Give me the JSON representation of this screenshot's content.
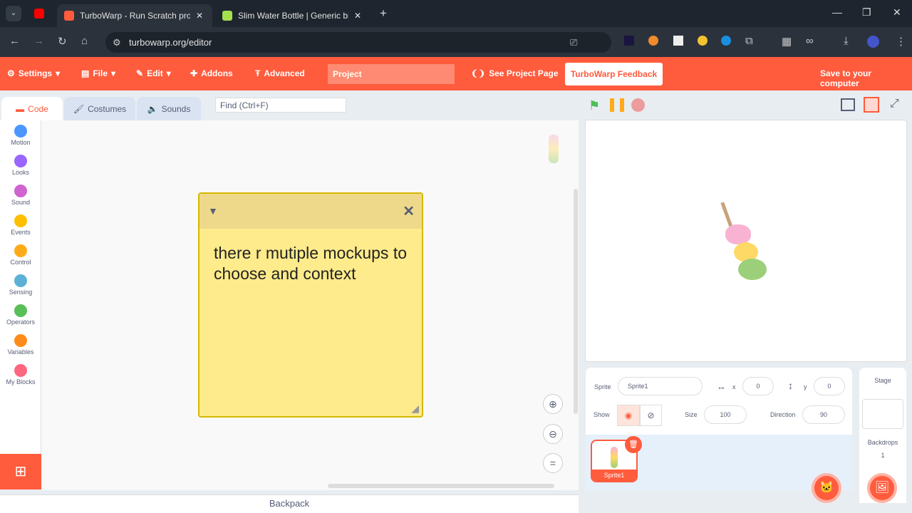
{
  "browser": {
    "tabs": [
      {
        "label": "TurboWarp - Run Scratch proje",
        "active": true
      },
      {
        "label": "Slim Water Bottle | Generic bra",
        "active": false
      }
    ],
    "url": "turbowarp.org/editor"
  },
  "menu": {
    "settings": "Settings",
    "file": "File",
    "edit": "Edit",
    "addons": "Addons",
    "advanced": "Advanced",
    "project_title": "Project",
    "see_project_page": "See Project Page",
    "feedback": "TurboWarp Feedback",
    "save": "Save to your computer"
  },
  "editor_tabs": {
    "code": "Code",
    "costumes": "Costumes",
    "sounds": "Sounds"
  },
  "find_placeholder": "Find (Ctrl+F)",
  "categories": [
    {
      "label": "Motion",
      "color": "#4c97ff"
    },
    {
      "label": "Looks",
      "color": "#9966ff"
    },
    {
      "label": "Sound",
      "color": "#cf63cf"
    },
    {
      "label": "Events",
      "color": "#ffbf00"
    },
    {
      "label": "Control",
      "color": "#ffab19"
    },
    {
      "label": "Sensing",
      "color": "#5cb1d6"
    },
    {
      "label": "Operators",
      "color": "#59c059"
    },
    {
      "label": "Variables",
      "color": "#ff8c1a"
    },
    {
      "label": "My Blocks",
      "color": "#ff6680"
    }
  ],
  "note": {
    "text": "there r mutiple mockups to choose and context"
  },
  "backpack": "Backpack",
  "sprite_info": {
    "sprite_label": "Sprite",
    "sprite_name": "Sprite1",
    "x_label": "x",
    "x": "0",
    "y_label": "y",
    "y": "0",
    "show_label": "Show",
    "size_label": "Size",
    "size": "100",
    "direction_label": "Direction",
    "direction": "90"
  },
  "sprites": [
    {
      "name": "Sprite1"
    }
  ],
  "stage_pane": {
    "title": "Stage",
    "backdrops_label": "Backdrops",
    "backdrops_count": "1"
  },
  "colors": {
    "accent": "#ff5b3d"
  }
}
